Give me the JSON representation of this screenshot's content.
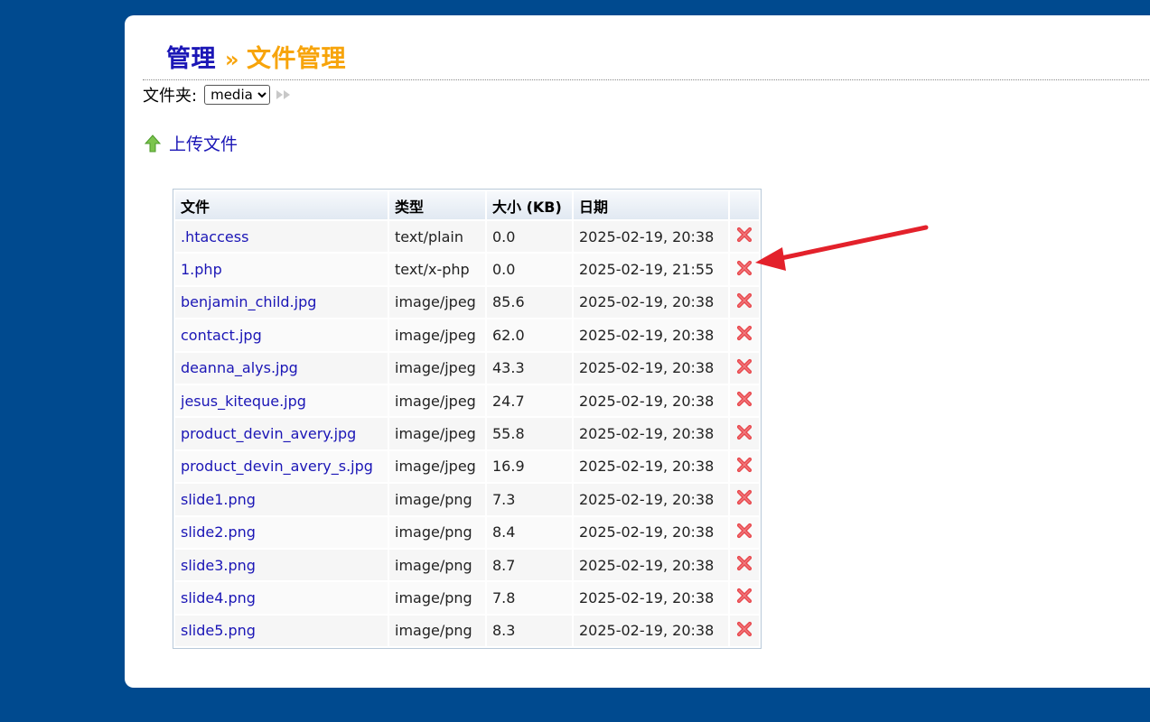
{
  "header": {
    "admin": "管理",
    "separator": "»",
    "current": "文件管理"
  },
  "folder": {
    "label": "文件夹:",
    "selected": "media"
  },
  "upload": {
    "label": "上传文件"
  },
  "table": {
    "columns": {
      "name": "文件",
      "type": "类型",
      "size": "大小 (KB)",
      "date": "日期"
    },
    "rows": [
      {
        "name": ".htaccess",
        "type": "text/plain",
        "size": "0.0",
        "date": "2025-02-19, 20:38"
      },
      {
        "name": "1.php",
        "type": "text/x-php",
        "size": "0.0",
        "date": "2025-02-19, 21:55"
      },
      {
        "name": "benjamin_child.jpg",
        "type": "image/jpeg",
        "size": "85.6",
        "date": "2025-02-19, 20:38"
      },
      {
        "name": "contact.jpg",
        "type": "image/jpeg",
        "size": "62.0",
        "date": "2025-02-19, 20:38"
      },
      {
        "name": "deanna_alys.jpg",
        "type": "image/jpeg",
        "size": "43.3",
        "date": "2025-02-19, 20:38"
      },
      {
        "name": "jesus_kiteque.jpg",
        "type": "image/jpeg",
        "size": "24.7",
        "date": "2025-02-19, 20:38"
      },
      {
        "name": "product_devin_avery.jpg",
        "type": "image/jpeg",
        "size": "55.8",
        "date": "2025-02-19, 20:38"
      },
      {
        "name": "product_devin_avery_s.jpg",
        "type": "image/jpeg",
        "size": "16.9",
        "date": "2025-02-19, 20:38"
      },
      {
        "name": "slide1.png",
        "type": "image/png",
        "size": "7.3",
        "date": "2025-02-19, 20:38"
      },
      {
        "name": "slide2.png",
        "type": "image/png",
        "size": "8.4",
        "date": "2025-02-19, 20:38"
      },
      {
        "name": "slide3.png",
        "type": "image/png",
        "size": "8.7",
        "date": "2025-02-19, 20:38"
      },
      {
        "name": "slide4.png",
        "type": "image/png",
        "size": "7.8",
        "date": "2025-02-19, 20:38"
      },
      {
        "name": "slide5.png",
        "type": "image/png",
        "size": "8.3",
        "date": "2025-02-19, 20:38"
      }
    ]
  },
  "icons": {
    "go": "forward-arrows-icon",
    "upload": "upload-arrow-icon",
    "delete": "delete-x-icon",
    "annotation": "red-pointer-arrow"
  },
  "colors": {
    "background": "#004a8f",
    "link": "#1b16b6",
    "accent": "#f7a40b",
    "delete": "#e8474c",
    "annotation_arrow": "#e3212b"
  }
}
